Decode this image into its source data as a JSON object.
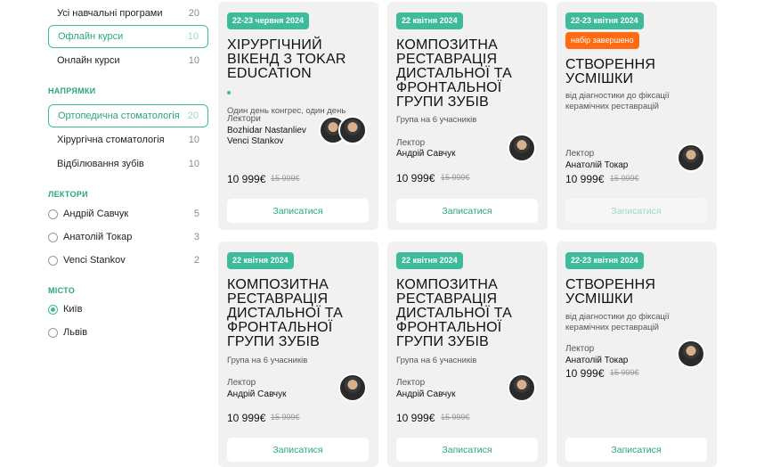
{
  "sidebar": {
    "programs": [
      {
        "label": "Усі навчальні програми",
        "count": "20"
      },
      {
        "label": "Офлайн курси",
        "count": "10"
      },
      {
        "label": "Онлайн курси",
        "count": "10"
      }
    ],
    "directions_title": "НАПРЯМКИ",
    "directions": [
      {
        "label": "Ортопедична стоматологія",
        "count": "20"
      },
      {
        "label": "Хірургічна стоматологія",
        "count": "10"
      },
      {
        "label": "Відбілювання зубів",
        "count": "10"
      }
    ],
    "lectors_title": "ЛЕКТОРИ",
    "lectors": [
      {
        "label": "Андрій Савчук",
        "count": "5"
      },
      {
        "label": "Анатолій Токар",
        "count": "3"
      },
      {
        "label": "Venci Stankov",
        "count": "2"
      }
    ],
    "city_title": "МІСТО",
    "cities": [
      {
        "label": "Київ"
      },
      {
        "label": "Львів"
      }
    ]
  },
  "cards": [
    {
      "date": "22-23 червня 2024",
      "title": "Хірургічний вікенд з Tokar Education",
      "subtitle": "Один день конгрес, один день",
      "overlap": "Лектори",
      "overlap2": "Bozhidar Nastanliev",
      "lector_name": "Venci Stankov",
      "price": "10 999€",
      "old_price": "15 999€",
      "button": "Записатися"
    },
    {
      "date": "22 квітня 2024",
      "title": "Композитна реставрація дистальної та фронтальної групи зубів",
      "subtitle": "Група на 6 учасників",
      "lector_label": "Лектор",
      "lector_name": "Андрій Савчук",
      "price": "10 999€",
      "old_price": "15 999€",
      "button": "Записатися"
    },
    {
      "date": "22-23 квітня 2024",
      "status": "набір завершено",
      "title": "Створення усмішки",
      "subtitle": "від діагностики до фіксації керамічних реставрацій",
      "lector_label": "Лектор",
      "lector_name": "Анатолій Токар",
      "price": "10 999€",
      "old_price": "15 999€",
      "button": "Записатися"
    },
    {
      "date": "22 квітня 2024",
      "title": "Композитна реставрація дистальної та фронтальної групи зубів",
      "subtitle": "Група на 6 учасників",
      "lector_label": "Лектор",
      "lector_name": "Андрій Савчук",
      "price": "10 999€",
      "old_price": "15 999€",
      "button": "Записатися"
    },
    {
      "date": "22 квітня 2024",
      "title": "Композитна реставрація дистальної та фронтальної групи зубів",
      "subtitle": "Група на 6 учасників",
      "lector_label": "Лектор",
      "lector_name": "Андрій Савчук",
      "price": "10 999€",
      "old_price": "15 999€",
      "button": "Записатися"
    },
    {
      "date": "22-23 квітня 2024",
      "title": "Створення усмішки",
      "subtitle": "від діагностики до фіксації керамічних реставрацій",
      "lector_label": "Лектор",
      "lector_name": "Анатолій Токар",
      "price": "10 999€",
      "old_price": "15 999€",
      "button": "Записатися"
    }
  ]
}
